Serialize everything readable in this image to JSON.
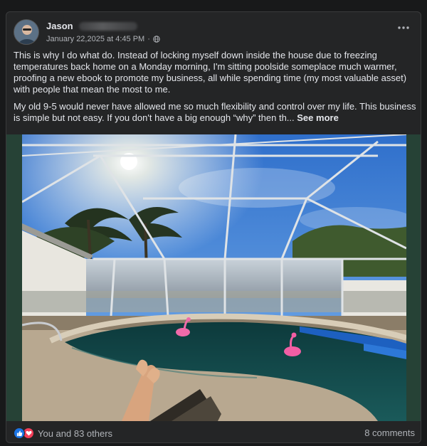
{
  "post": {
    "author": {
      "name": "Jason"
    },
    "timestamp": "January 22,2025 at 4:45 PM",
    "separator": "·",
    "privacy_icon": "globe-icon",
    "menu_icon": "more-options-icon",
    "body": {
      "paragraph_1": "This is why I do what do. Instead of locking myself down inside the house due to freezing temperatures back home on  a Monday morning, I'm sitting poolside someplace much warmer, proofing a new ebook to promote my business, all while spending time (my most valuable asset) with people that mean the most to me.",
      "paragraph_2": "My old 9-5 would never have allowed me so much flexibility and control over my life. This business is simple but not easy. If you don't have a big enough “why” then th...",
      "see_more": "See more"
    },
    "photo": {
      "icon": "photo"
    },
    "footer": {
      "reaction_icons": [
        "like-icon",
        "love-icon"
      ],
      "reactions_text": "You and 83 others",
      "comments_text": "8 comments"
    }
  },
  "colors": {
    "background": "#18191a",
    "card": "#242526",
    "text_primary": "#e4e6eb",
    "text_secondary": "#b0b3b8",
    "like_blue": "#1b74e4",
    "love_red": "#f33e58",
    "photo_border": "#264236"
  }
}
